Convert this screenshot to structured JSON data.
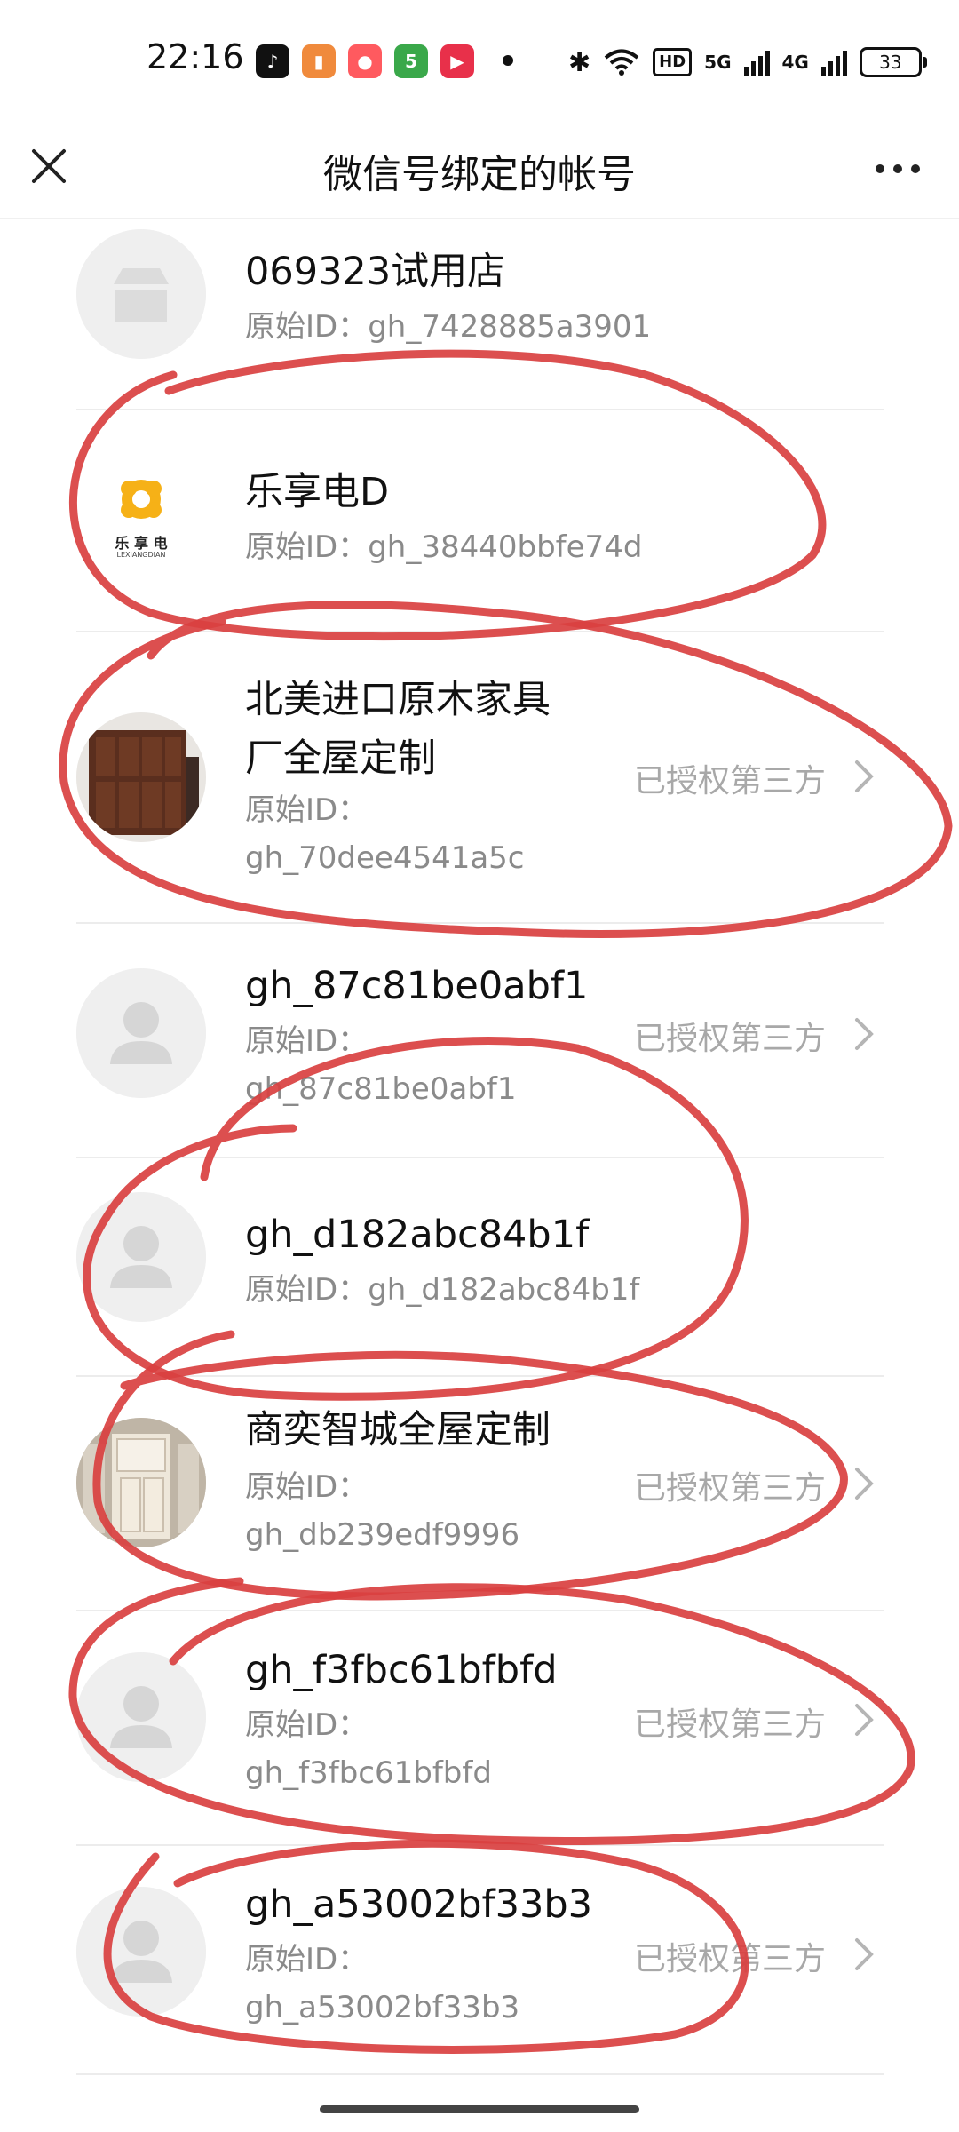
{
  "status_bar": {
    "time": "22:16",
    "app_icons": [
      "tiktok-icon",
      "reader-icon",
      "kuaishou-icon",
      "58-icon",
      "video-icon"
    ],
    "net_badge": "HD",
    "sig1": "5G",
    "sig2": "4G",
    "battery": "33"
  },
  "header": {
    "title": "微信号绑定的帐号",
    "close_icon": "close-icon",
    "more_icon": "more-icon"
  },
  "accounts": [
    {
      "name": "069323试用店",
      "id_label": "原始ID：",
      "id_value": "gh_7428885a3901",
      "authorized": "",
      "avatar": "store-placeholder-icon"
    },
    {
      "name": "乐享电D",
      "id_label": "原始ID：",
      "id_value": "gh_38440bbfe74d",
      "authorized": "",
      "avatar": "lexiangdian-logo",
      "logo_text": "乐 享 电",
      "logo_sub": "LEXIANGDIAN"
    },
    {
      "name_line1": "北美进口原木家具",
      "name_line2": "厂全屋定制",
      "id_label": "原始ID：",
      "id_value": "gh_70dee4541a5c",
      "authorized": "已授权第三方",
      "avatar": "wardrobe-photo"
    },
    {
      "name": "gh_87c81be0abf1",
      "id_label": "原始ID：",
      "id_value": "gh_87c81be0abf1",
      "authorized": "已授权第三方",
      "avatar": "user-placeholder-icon"
    },
    {
      "name": "gh_d182abc84b1f",
      "id_label": "原始ID：",
      "id_value": "gh_d182abc84b1f",
      "authorized": "",
      "avatar": "user-placeholder-icon"
    },
    {
      "name": "商奕智城全屋定制",
      "id_label": "原始ID：",
      "id_value": "gh_db239edf9996",
      "authorized": "已授权第三方",
      "avatar": "door-photo"
    },
    {
      "name": "gh_f3fbc61bfbfd",
      "id_label": "原始ID：",
      "id_value": "gh_f3fbc61bfbfd",
      "authorized": "已授权第三方",
      "avatar": "user-placeholder-icon"
    },
    {
      "name": "gh_a53002bf33b3",
      "id_label": "原始ID：",
      "id_value": "gh_a53002bf33b3",
      "authorized": "已授权第三方",
      "avatar": "user-placeholder-icon"
    }
  ],
  "colors": {
    "annotation_stroke": "#d94040",
    "secondary_text": "#8a8a8a",
    "auth_text": "#a8a8a8"
  }
}
